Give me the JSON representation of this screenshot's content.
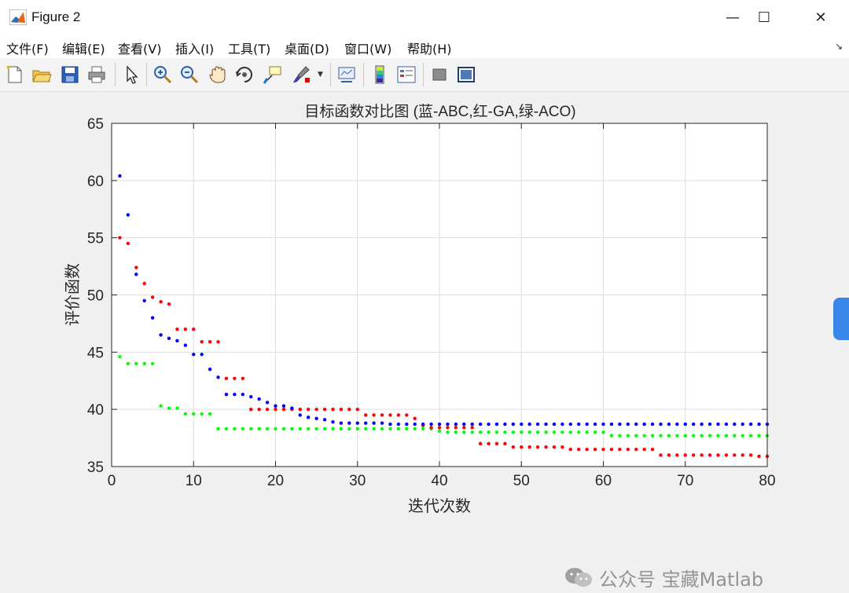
{
  "window": {
    "title": "Figure 2"
  },
  "window_buttons": {
    "minimize": "—",
    "maximize": "☐",
    "close": "✕"
  },
  "menu": [
    "文件(F)",
    "编辑(E)",
    "查看(V)",
    "插入(I)",
    "工具(T)",
    "桌面(D)",
    "窗口(W)",
    "帮助(H)"
  ],
  "toolbar_icons": [
    "new-figure-icon",
    "open-file-icon",
    "save-icon",
    "print-icon",
    "pointer-icon",
    "zoom-in-icon",
    "zoom-out-icon",
    "pan-hand-icon",
    "rotate-3d-icon",
    "data-cursor-icon",
    "brush-icon",
    "link-plot-icon",
    "colorbar-icon",
    "legend-icon",
    "hide-plot-tools-icon",
    "show-plot-tools-icon"
  ],
  "watermark": {
    "text": "公众号 宝藏Matlab"
  },
  "chart_data": {
    "type": "scatter",
    "title": "目标函数对比图 (蓝-ABC,红-GA,绿-ACO)",
    "xlabel": "迭代次数",
    "ylabel": "评价函数",
    "xlim": [
      0,
      80
    ],
    "ylim": [
      35,
      65
    ],
    "xticks": [
      0,
      10,
      20,
      30,
      40,
      50,
      60,
      70,
      80
    ],
    "yticks": [
      35,
      40,
      45,
      50,
      55,
      60,
      65
    ],
    "grid": true,
    "series": [
      {
        "color": "#0000ff",
        "x": [
          1,
          2,
          3,
          4,
          5,
          6,
          7,
          8,
          9,
          10,
          11,
          12,
          13,
          14,
          15,
          16,
          17,
          18,
          19,
          20,
          21,
          22,
          23,
          24,
          25,
          26,
          27,
          28,
          29,
          30,
          31,
          32,
          33,
          34,
          35,
          36,
          37,
          38,
          39,
          40,
          41,
          42,
          43,
          44,
          45,
          46,
          47,
          48,
          49,
          50,
          51,
          52,
          53,
          54,
          55,
          56,
          57,
          58,
          59,
          60,
          61,
          62,
          63,
          64,
          65,
          66,
          67,
          68,
          69,
          70,
          71,
          72,
          73,
          74,
          75,
          76,
          77,
          78,
          79,
          80
        ],
        "y": [
          60.4,
          57.0,
          51.8,
          49.5,
          48.0,
          46.5,
          46.2,
          46.0,
          45.6,
          44.8,
          44.8,
          43.5,
          42.8,
          41.3,
          41.3,
          41.3,
          41.1,
          40.9,
          40.6,
          40.3,
          40.3,
          40.1,
          39.5,
          39.3,
          39.2,
          39.1,
          38.9,
          38.8,
          38.8,
          38.8,
          38.8,
          38.8,
          38.8,
          38.7,
          38.7,
          38.7,
          38.7,
          38.7,
          38.7,
          38.7,
          38.7,
          38.7,
          38.7,
          38.7,
          38.7,
          38.7,
          38.7,
          38.7,
          38.7,
          38.7,
          38.7,
          38.7,
          38.7,
          38.7,
          38.7,
          38.7,
          38.7,
          38.7,
          38.7,
          38.7,
          38.7,
          38.7,
          38.7,
          38.7,
          38.7,
          38.7,
          38.7,
          38.7,
          38.7,
          38.7,
          38.7,
          38.7,
          38.7,
          38.7,
          38.7,
          38.7,
          38.7,
          38.7,
          38.7,
          38.7
        ]
      },
      {
        "color": "#ff0000",
        "x": [
          1,
          2,
          3,
          4,
          5,
          6,
          7,
          8,
          9,
          10,
          11,
          12,
          13,
          14,
          15,
          16,
          17,
          18,
          19,
          20,
          21,
          22,
          23,
          24,
          25,
          26,
          27,
          28,
          29,
          30,
          31,
          32,
          33,
          34,
          35,
          36,
          37,
          38,
          39,
          40,
          41,
          42,
          43,
          44,
          45,
          46,
          47,
          48,
          49,
          50,
          51,
          52,
          53,
          54,
          55,
          56,
          57,
          58,
          59,
          60,
          61,
          62,
          63,
          64,
          65,
          66,
          67,
          68,
          69,
          70,
          71,
          72,
          73,
          74,
          75,
          76,
          77,
          78,
          79,
          80
        ],
        "y": [
          55.0,
          54.5,
          52.4,
          51.0,
          49.8,
          49.4,
          49.2,
          47.0,
          47.0,
          47.0,
          45.9,
          45.9,
          45.9,
          42.7,
          42.7,
          42.7,
          40.0,
          40.0,
          40.0,
          40.0,
          40.0,
          40.0,
          40.0,
          40.0,
          40.0,
          40.0,
          40.0,
          40.0,
          40.0,
          40.0,
          39.5,
          39.5,
          39.5,
          39.5,
          39.5,
          39.5,
          39.2,
          38.6,
          38.4,
          38.4,
          38.4,
          38.4,
          38.4,
          38.4,
          37.0,
          37.0,
          37.0,
          37.0,
          36.7,
          36.7,
          36.7,
          36.7,
          36.7,
          36.7,
          36.7,
          36.5,
          36.5,
          36.5,
          36.5,
          36.5,
          36.5,
          36.5,
          36.5,
          36.5,
          36.5,
          36.5,
          36.0,
          36.0,
          36.0,
          36.0,
          36.0,
          36.0,
          36.0,
          36.0,
          36.0,
          36.0,
          36.0,
          36.0,
          35.9,
          35.9
        ]
      },
      {
        "color": "#00ff00",
        "x": [
          1,
          2,
          3,
          4,
          5,
          6,
          7,
          8,
          9,
          10,
          11,
          12,
          13,
          14,
          15,
          16,
          17,
          18,
          19,
          20,
          21,
          22,
          23,
          24,
          25,
          26,
          27,
          28,
          29,
          30,
          31,
          32,
          33,
          34,
          35,
          36,
          37,
          38,
          39,
          40,
          41,
          42,
          43,
          44,
          45,
          46,
          47,
          48,
          49,
          50,
          51,
          52,
          53,
          54,
          55,
          56,
          57,
          58,
          59,
          60,
          61,
          62,
          63,
          64,
          65,
          66,
          67,
          68,
          69,
          70,
          71,
          72,
          73,
          74,
          75,
          76,
          77,
          78,
          79,
          80
        ],
        "y": [
          44.6,
          44.0,
          44.0,
          44.0,
          44.0,
          40.3,
          40.1,
          40.1,
          39.6,
          39.6,
          39.6,
          39.6,
          38.3,
          38.3,
          38.3,
          38.3,
          38.3,
          38.3,
          38.3,
          38.3,
          38.3,
          38.3,
          38.3,
          38.3,
          38.3,
          38.3,
          38.3,
          38.3,
          38.3,
          38.3,
          38.3,
          38.3,
          38.3,
          38.3,
          38.3,
          38.3,
          38.3,
          38.3,
          38.3,
          38.1,
          38.0,
          38.0,
          38.0,
          38.0,
          38.0,
          38.0,
          38.0,
          38.0,
          38.0,
          38.0,
          38.0,
          38.0,
          38.0,
          38.0,
          38.0,
          38.0,
          38.0,
          38.0,
          38.0,
          38.0,
          37.7,
          37.7,
          37.7,
          37.7,
          37.7,
          37.7,
          37.7,
          37.7,
          37.7,
          37.7,
          37.7,
          37.7,
          37.7,
          37.7,
          37.7,
          37.7,
          37.7,
          37.7,
          37.7,
          37.7
        ]
      }
    ]
  }
}
